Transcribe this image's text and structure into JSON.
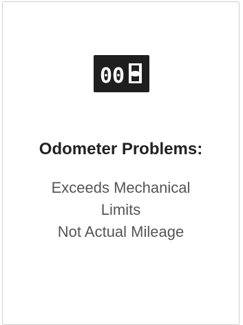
{
  "card": {
    "icon": "odometer-icon",
    "odometer_digits": "00",
    "title": "Odometer Problems:",
    "problems": [
      "Exceeds Mechanical",
      "Limits",
      "Not Actual Mileage"
    ]
  },
  "colors": {
    "icon_background": "#1f1f1f",
    "title_text": "#222222",
    "body_text": "#555555",
    "card_border": "#cfcfcf"
  }
}
